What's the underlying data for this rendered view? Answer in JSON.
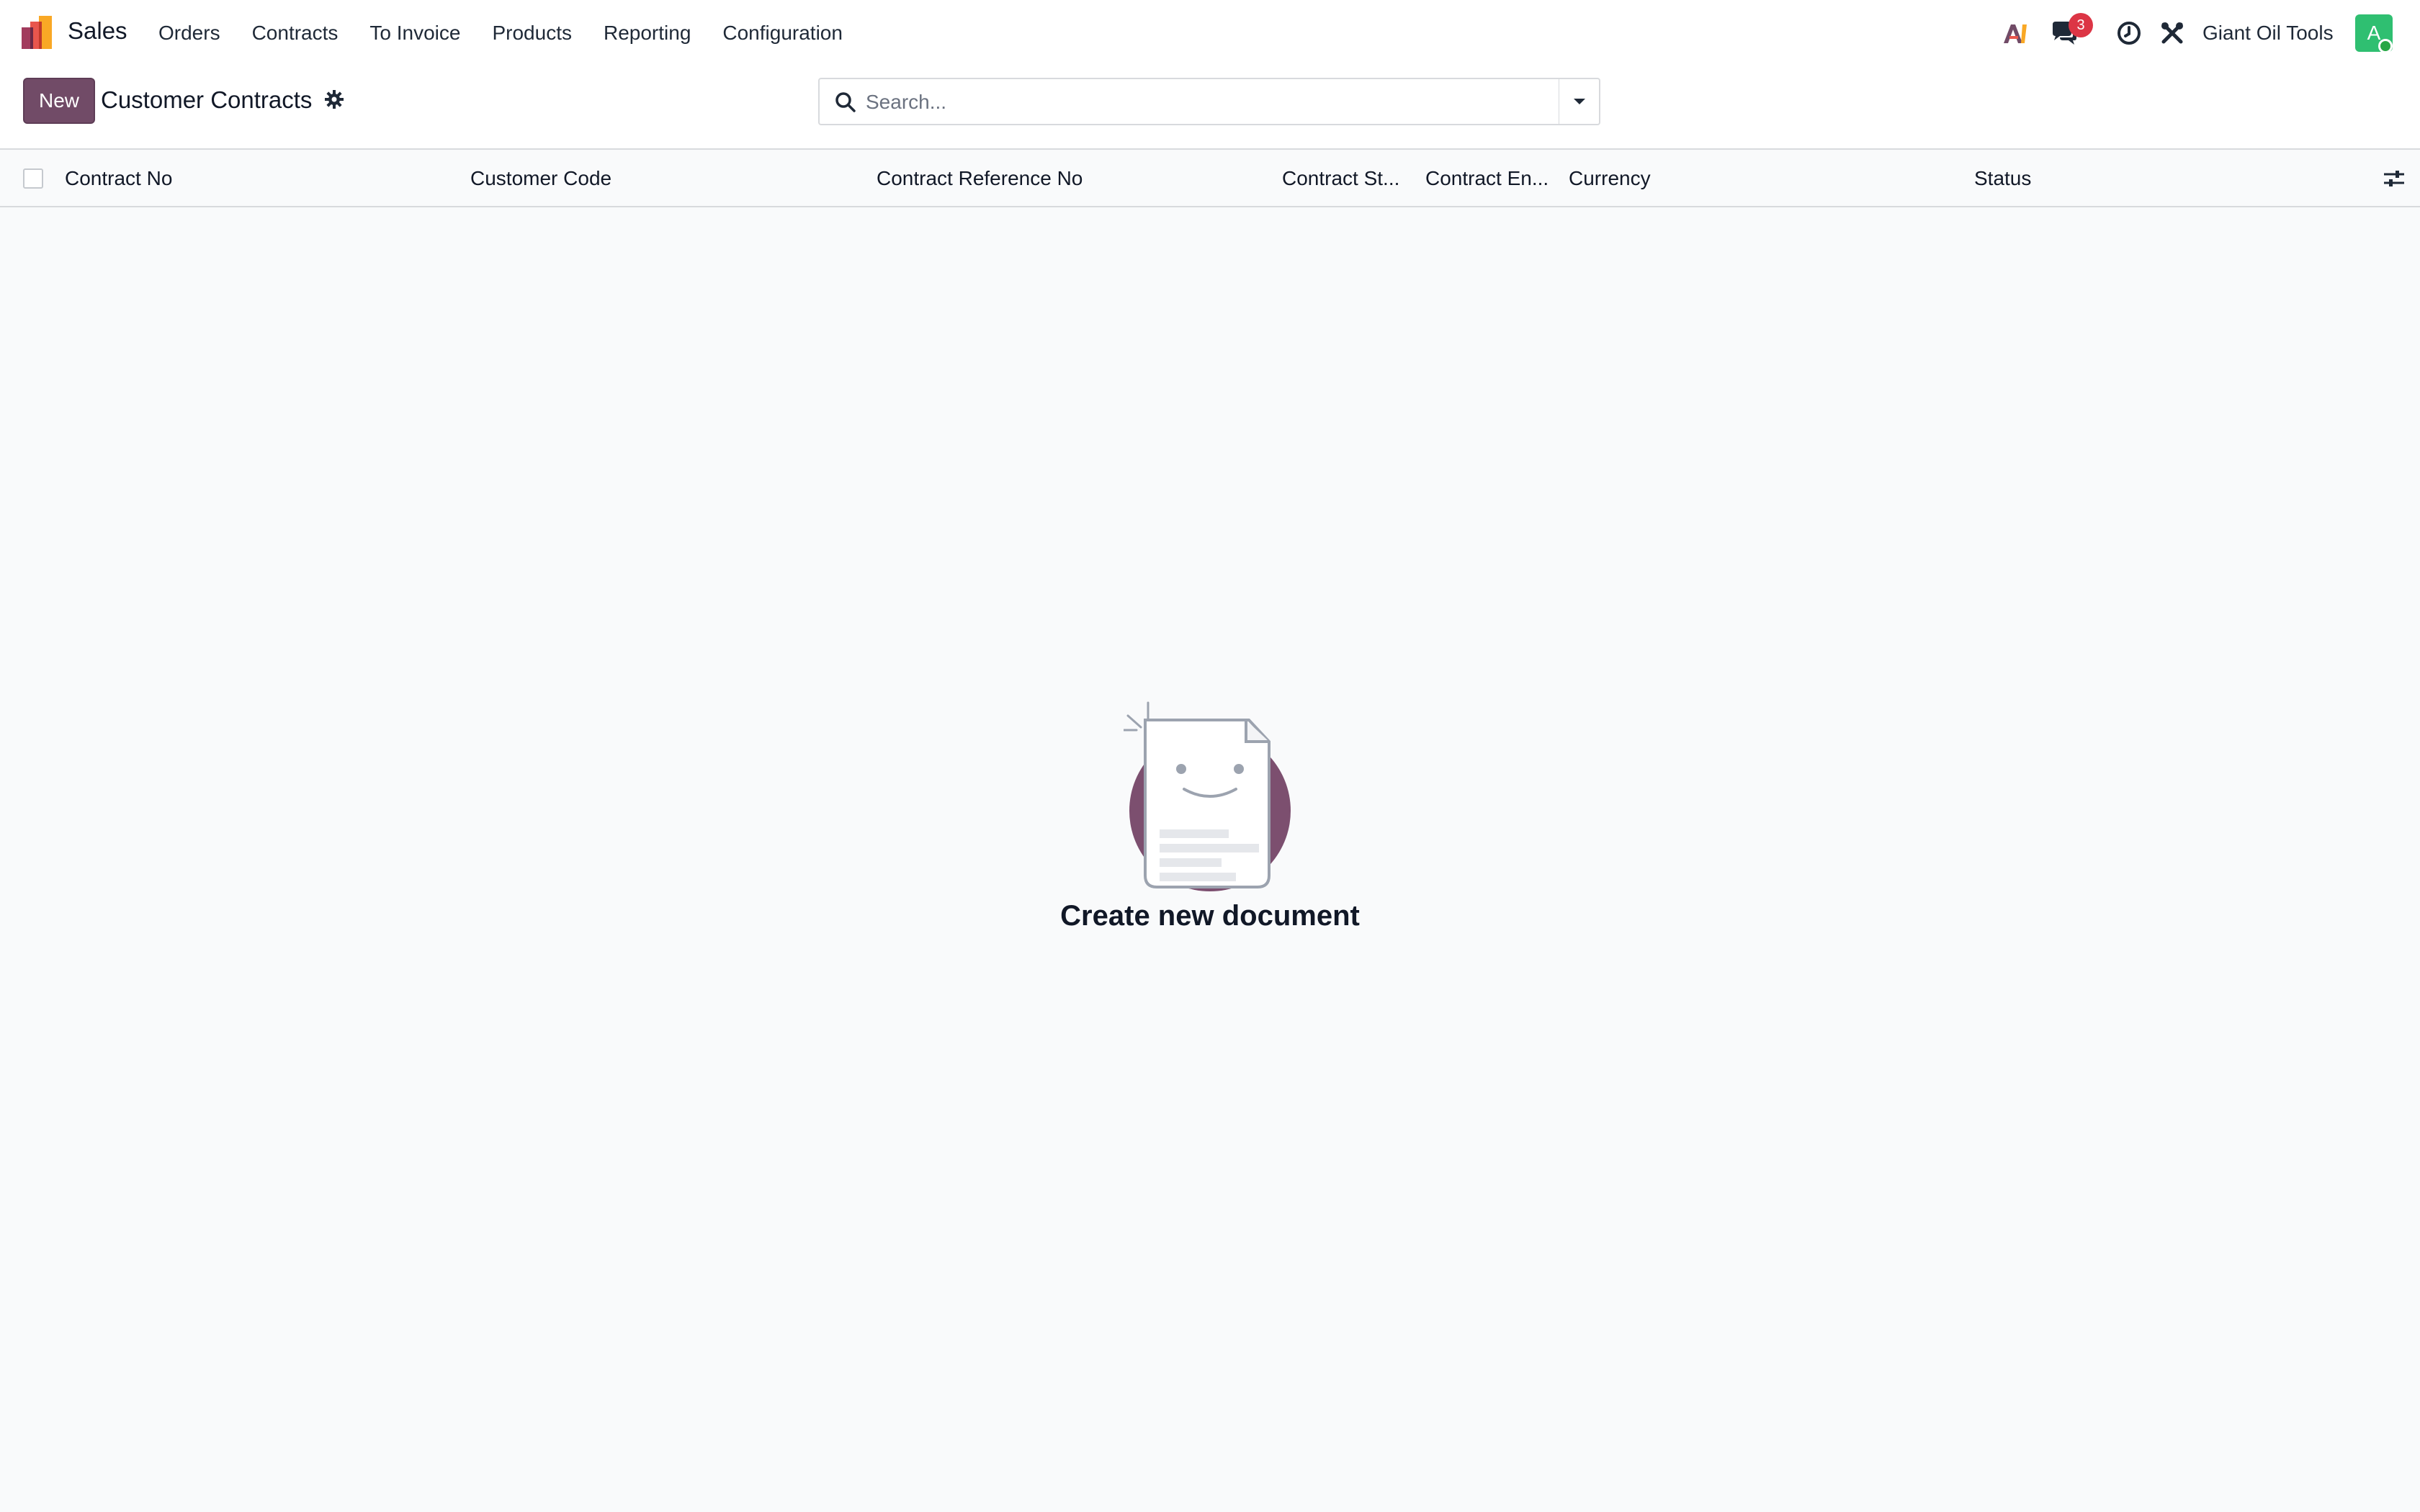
{
  "app": {
    "name": "Sales",
    "menu": [
      {
        "label": "Orders"
      },
      {
        "label": "Contracts"
      },
      {
        "label": "To Invoice"
      },
      {
        "label": "Products"
      },
      {
        "label": "Reporting"
      },
      {
        "label": "Configuration"
      }
    ]
  },
  "systray": {
    "messages_count": "3",
    "company": "Giant Oil Tools",
    "avatar_initial": "A"
  },
  "control_panel": {
    "new_label": "New",
    "title": "Customer Contracts",
    "search_placeholder": "Search..."
  },
  "list": {
    "columns": [
      {
        "label": "Contract No"
      },
      {
        "label": "Customer Code"
      },
      {
        "label": "Contract Reference No"
      },
      {
        "label": "Contract St..."
      },
      {
        "label": "Contract En..."
      },
      {
        "label": "Currency"
      },
      {
        "label": "Status"
      }
    ]
  },
  "empty_state": {
    "title": "Create new document"
  },
  "colors": {
    "brand": "#714b67",
    "badge": "#dc3545",
    "avatar": "#2fbf71"
  }
}
